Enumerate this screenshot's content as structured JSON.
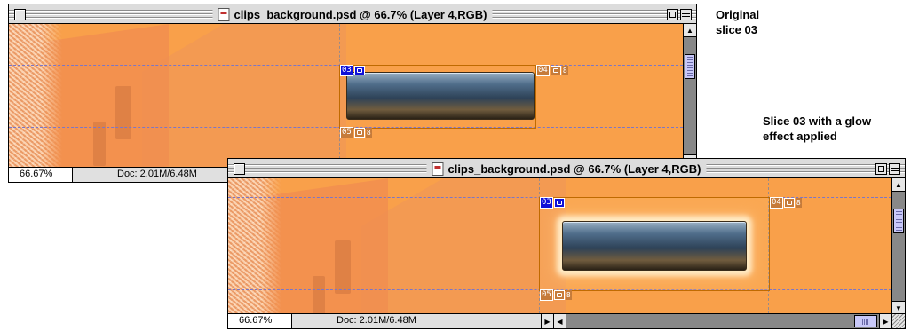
{
  "captions": {
    "original_line1": "Original",
    "original_line2": "slice 03",
    "glow_line1": "Slice 03 with a glow",
    "glow_line2": "effect applied"
  },
  "window_original": {
    "title": "clips_background.psd @ 66.7% (Layer 4,RGB)",
    "zoom": "66.67%",
    "doc_size": "Doc: 2.01M/6.48M",
    "slices": [
      {
        "number": "03",
        "active": true
      },
      {
        "number": "04",
        "linked": "8"
      },
      {
        "number": "05",
        "linked": "8"
      }
    ]
  },
  "window_glow": {
    "title": "clips_background.psd @ 66.7% (Layer 4,RGB)",
    "zoom": "66.67%",
    "doc_size": "Doc: 2.01M/6.48M",
    "slices": [
      {
        "number": "03",
        "active": true
      },
      {
        "number": "04",
        "linked": "8"
      },
      {
        "number": "05",
        "linked": "8"
      }
    ]
  },
  "colors": {
    "canvas": "#f9a04a",
    "slice_tag": "#c67b3a",
    "active_slice_tag": "#1010d8",
    "scroll_thumb": "#c8c8f8"
  },
  "icons": [
    "close-box-icon",
    "document-icon",
    "zoom-box-icon",
    "collapse-box-icon",
    "slice-image-icon",
    "scroll-up-arrow-icon",
    "scroll-down-arrow-icon",
    "scroll-left-arrow-icon",
    "scroll-right-arrow-icon",
    "grow-box-icon"
  ]
}
